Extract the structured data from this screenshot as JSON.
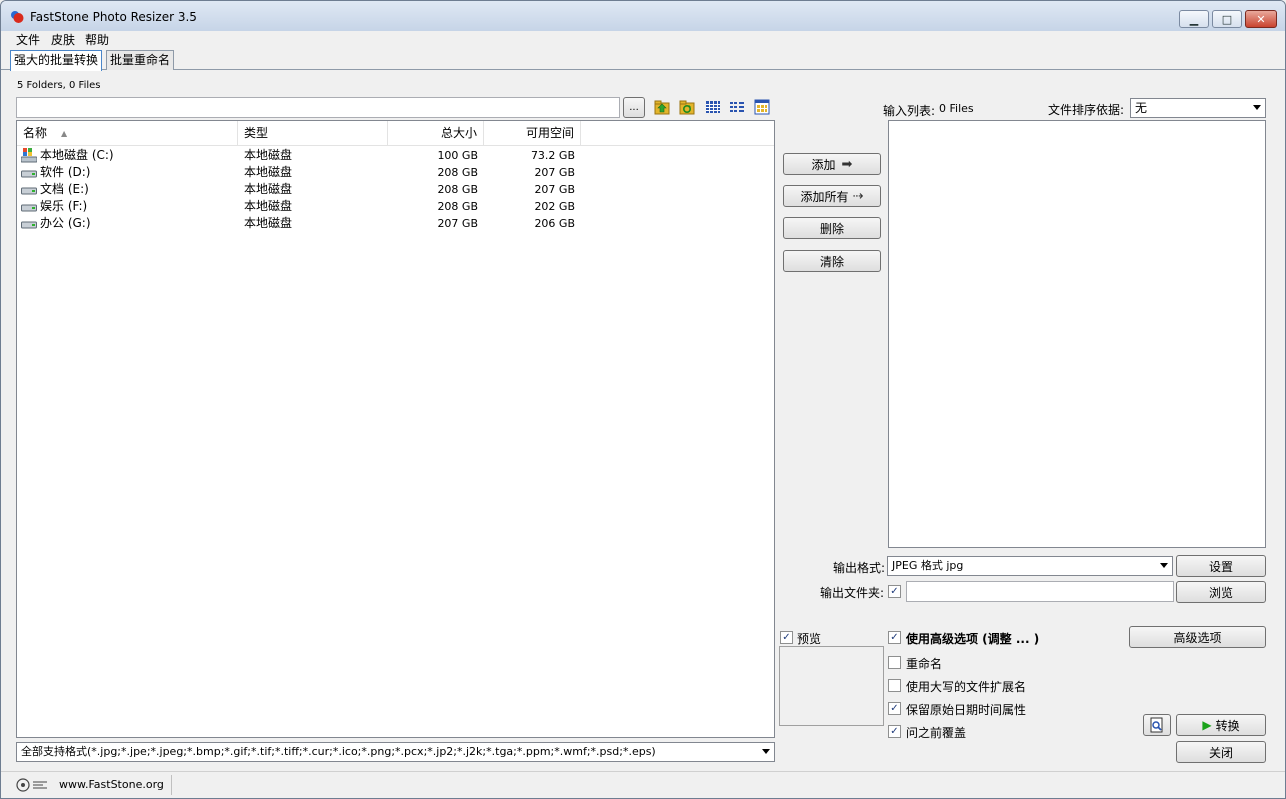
{
  "window": {
    "title": "FastStone Photo Resizer 3.5",
    "minimize_glyph": "▁",
    "maximize_glyph": "□",
    "close_glyph": "✕"
  },
  "menu": [
    "文件",
    "皮肤",
    "帮助"
  ],
  "tabs": [
    {
      "label": "强大的批量转换",
      "active": true
    },
    {
      "label": "批量重命名",
      "active": false
    }
  ],
  "browser": {
    "status": "5 Folders, 0 Files",
    "path_value": "",
    "browse_label": "...",
    "toolbar_icons": [
      "folder-up-icon",
      "refresh-folder-icon",
      "details-view-icon",
      "list-view-icon",
      "thumbnail-view-icon"
    ],
    "columns": [
      "名称",
      "类型",
      "总大小",
      "可用空间"
    ],
    "rows": [
      {
        "name": "本地磁盘 (C:)",
        "type": "本地磁盘",
        "total": "100 GB",
        "free": "73.2 GB",
        "icon": "system-drive-icon"
      },
      {
        "name": "软件 (D:)",
        "type": "本地磁盘",
        "total": "208 GB",
        "free": "207 GB",
        "icon": "drive-icon"
      },
      {
        "name": "文档 (E:)",
        "type": "本地磁盘",
        "total": "208 GB",
        "free": "207 GB",
        "icon": "drive-icon"
      },
      {
        "name": "娱乐 (F:)",
        "type": "本地磁盘",
        "total": "208 GB",
        "free": "202 GB",
        "icon": "drive-icon"
      },
      {
        "name": "办公 (G:)",
        "type": "本地磁盘",
        "total": "207 GB",
        "free": "206 GB",
        "icon": "drive-icon"
      }
    ],
    "filter": "全部支持格式(*.jpg;*.jpe;*.jpeg;*.bmp;*.gif;*.tif;*.tiff;*.cur;*.ico;*.png;*.pcx;*.jp2;*.j2k;*.tga;*.ppm;*.wmf;*.psd;*.eps)"
  },
  "middle": {
    "add": "添加",
    "add_all": "添加所有",
    "delete": "删除",
    "clear": "清除"
  },
  "input_list": {
    "label": "输入列表:",
    "count": "0 Files",
    "sort_label": "文件排序依据:",
    "sort_value": "无"
  },
  "output": {
    "format_label": "输出格式:",
    "format_value": "JPEG 格式 jpg",
    "settings": "设置",
    "folder_label": "输出文件夹:",
    "folder_checked": true,
    "folder_value": "",
    "browse": "浏览"
  },
  "preview": {
    "label": "预览",
    "checked": true
  },
  "options": {
    "advanced": {
      "label": "使用高级选项 (调整 ... )",
      "checked": true
    },
    "rename": {
      "label": "重命名",
      "checked": false
    },
    "uppercase_ext": {
      "label": "使用大写的文件扩展名",
      "checked": false
    },
    "keep_date": {
      "label": "保留原始日期时间属性",
      "checked": true
    },
    "overwrite": {
      "label": "问之前覆盖",
      "checked": true
    },
    "advanced_button": "高级选项"
  },
  "actions": {
    "convert": "转换",
    "close": "关闭"
  },
  "statusbar": {
    "website": "www.FastStone.org"
  },
  "colors": {
    "accent": "#4a86c9",
    "convert_arrow": "#1aa31a",
    "folder_up": "#e3b52b",
    "grid_icon": "#2a54b0"
  }
}
